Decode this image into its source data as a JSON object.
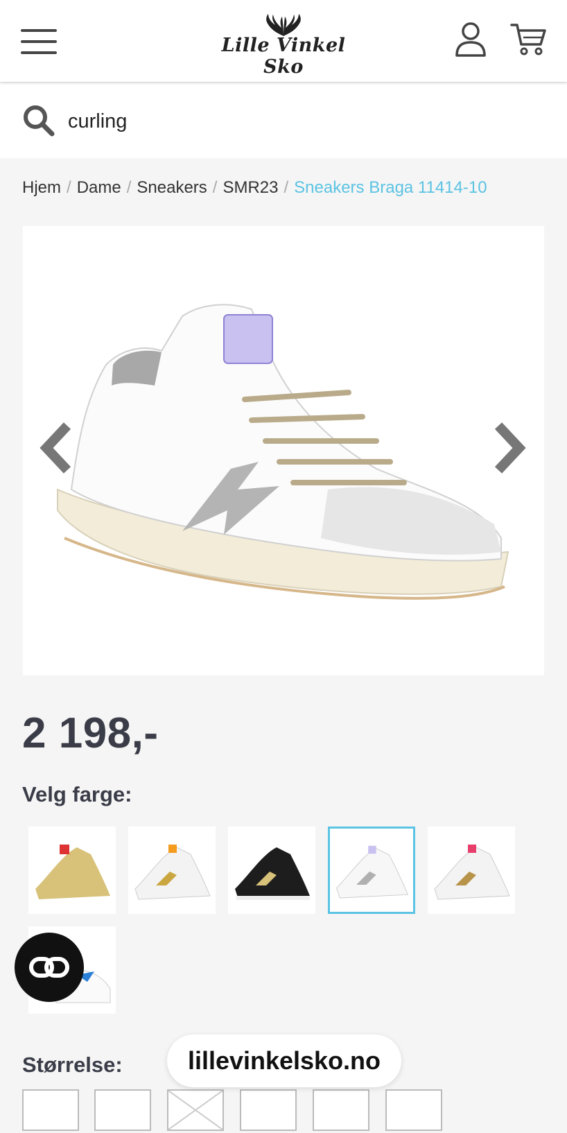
{
  "header": {
    "logo_text": "Lille Vinkel Sko",
    "icons": [
      "menu-icon",
      "antler-logo-icon",
      "user-icon",
      "cart-icon"
    ]
  },
  "search": {
    "value": "curling",
    "icon": "search-icon"
  },
  "breadcrumb": {
    "items": [
      "Hjem",
      "Dame",
      "Sneakers",
      "SMR23"
    ],
    "current": "Sneakers Braga 11414-10",
    "separator": "/"
  },
  "product": {
    "price": "2 198,-",
    "color_label": "Velg farge:",
    "size_label": "Størrelse:",
    "swatches": [
      {
        "color": "gold",
        "selected": false
      },
      {
        "color": "white-gold-glitter",
        "selected": false
      },
      {
        "color": "black",
        "selected": false
      },
      {
        "color": "white-silver-glitter",
        "selected": true
      },
      {
        "color": "white-leopard",
        "selected": false
      },
      {
        "color": "white-blue",
        "selected": false
      }
    ]
  },
  "overlay": {
    "url": "lillevinkelsko.no"
  },
  "colors": {
    "accent": "#5bc3e3",
    "text": "#3a3d48",
    "background": "#f5f5f5"
  }
}
